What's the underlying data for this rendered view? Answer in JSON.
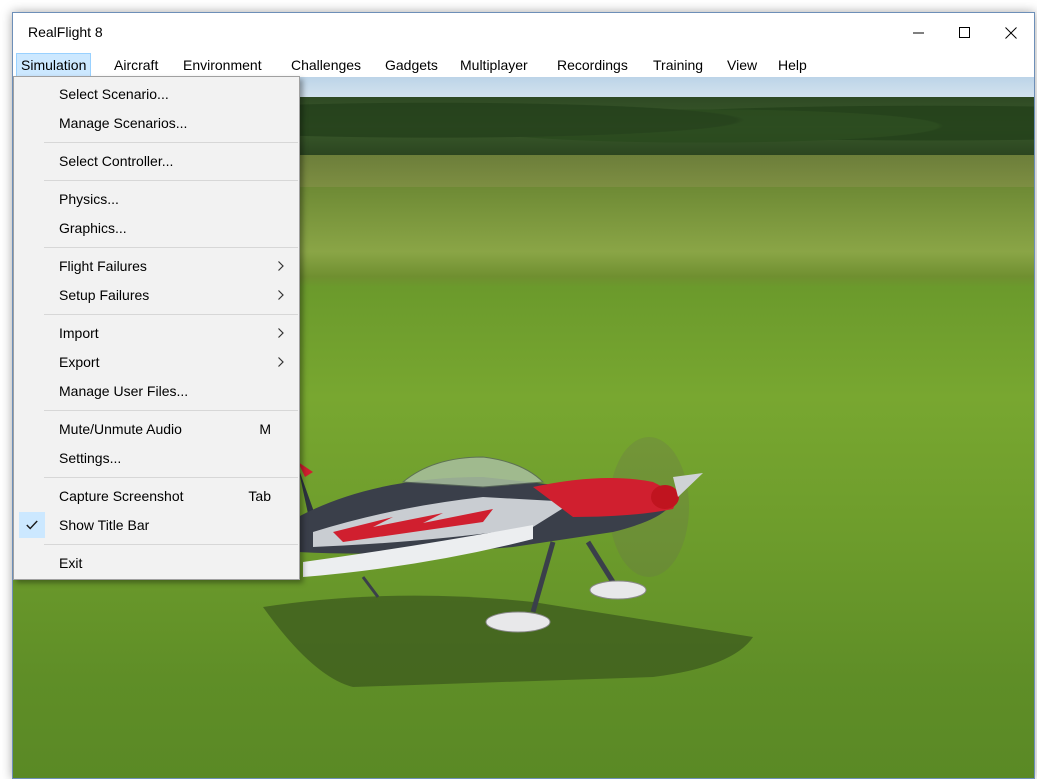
{
  "app": {
    "title": "RealFlight 8"
  },
  "window_controls": {
    "minimize_icon": "minimize-icon",
    "maximize_icon": "maximize-icon",
    "close_icon": "close-icon"
  },
  "menubar": {
    "items": [
      {
        "label": "Simulation",
        "active": true
      },
      {
        "label": "Aircraft"
      },
      {
        "label": "Environment"
      },
      {
        "label": "Challenges"
      },
      {
        "label": "Gadgets"
      },
      {
        "label": "Multiplayer"
      },
      {
        "label": "Recordings"
      },
      {
        "label": "Training"
      },
      {
        "label": "View"
      },
      {
        "label": "Help"
      }
    ]
  },
  "simulation_menu": {
    "items": [
      {
        "label": "Select Scenario..."
      },
      {
        "label": "Manage Scenarios..."
      },
      {
        "label": "Select Controller..."
      },
      {
        "label": "Physics..."
      },
      {
        "label": "Graphics..."
      },
      {
        "label": "Flight Failures",
        "submenu": true
      },
      {
        "label": "Setup Failures",
        "submenu": true
      },
      {
        "label": "Import",
        "submenu": true
      },
      {
        "label": "Export",
        "submenu": true
      },
      {
        "label": "Manage User Files..."
      },
      {
        "label": "Mute/Unmute Audio",
        "shortcut": "M"
      },
      {
        "label": "Settings..."
      },
      {
        "label": "Capture Screenshot",
        "shortcut": "Tab"
      },
      {
        "label": "Show Title Bar",
        "checked": true
      },
      {
        "label": "Exit"
      }
    ]
  },
  "colors": {
    "menu_highlight": "#cce8ff",
    "menu_bg": "#f2f2f2",
    "grass": "#6b9a2c",
    "plane_red": "#d01f2f"
  }
}
